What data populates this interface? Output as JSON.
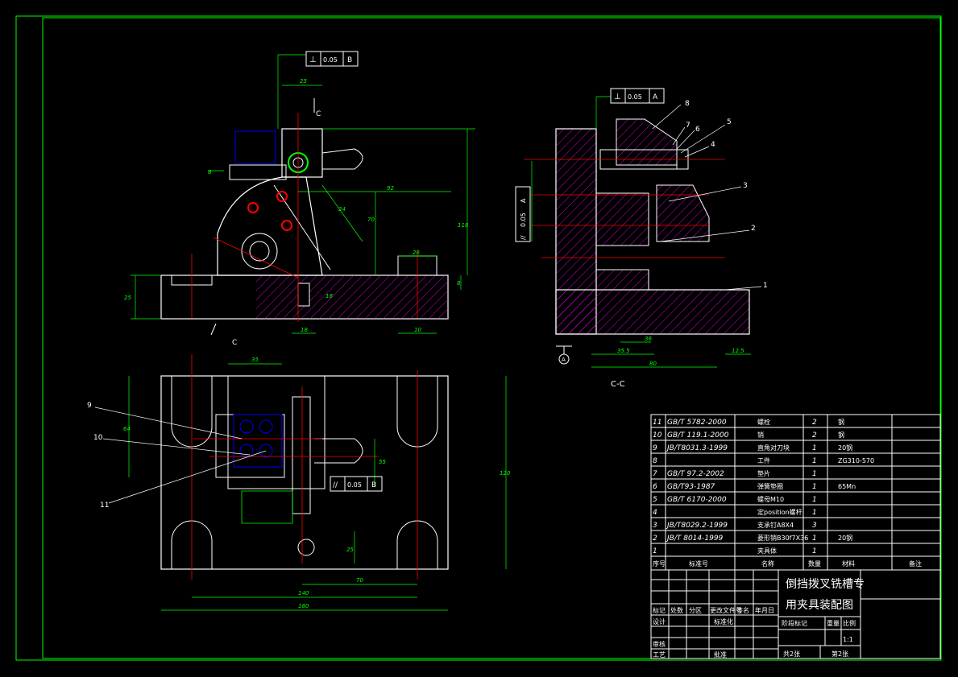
{
  "colors": {
    "background": "#000000",
    "border": "#00ff00",
    "part_outline": "#ffffff",
    "dimension": "#00ff00",
    "centerline": "#ff0000",
    "hatch": "#ff00ff",
    "hidden_blue": "#0000ff",
    "highlight_red": "#ff0000"
  },
  "views": {
    "front": {
      "section_label_top": "C",
      "section_label_bottom": "C",
      "tolerance_frame": [
        "⊥",
        "0.05",
        "B"
      ],
      "dims": [
        "25",
        "92",
        "8",
        "70",
        "24",
        "118",
        "25",
        "26",
        "8",
        "18",
        "18",
        "10"
      ]
    },
    "section": {
      "title": "C-C",
      "tolerance_frame": [
        "⊥",
        "0.05",
        "A"
      ],
      "side_frame": [
        "//",
        "0.05",
        "A"
      ],
      "datum": "A",
      "dims": [
        "36",
        "35.5",
        "80",
        "12.5"
      ],
      "balloons": [
        "8",
        "7",
        "6",
        "5",
        "4",
        "3",
        "2",
        "1"
      ]
    },
    "top": {
      "tolerance_frame": [
        "//",
        "0.05",
        "B"
      ],
      "dims": [
        "35",
        "64",
        "55",
        "120",
        "25",
        "70",
        "140",
        "180"
      ],
      "balloons": [
        "9",
        "10",
        "11"
      ]
    }
  },
  "bom": {
    "rows": [
      {
        "no": "11",
        "std": "GB/T 5782-2000",
        "name": "螺栓",
        "qty": "2",
        "mat": "钢",
        "note": ""
      },
      {
        "no": "10",
        "std": "GB/T 119.1-2000",
        "name": "销",
        "qty": "2",
        "mat": "钢",
        "note": ""
      },
      {
        "no": "9",
        "std": "JB/T8031.3-1999",
        "name": "直角对刀块",
        "qty": "1",
        "mat": "20钢",
        "note": ""
      },
      {
        "no": "8",
        "std": "",
        "name": "工件",
        "qty": "1",
        "mat": "ZG310-570",
        "note": ""
      },
      {
        "no": "7",
        "std": "GB/T 97.2-2002",
        "name": "垫片",
        "qty": "1",
        "mat": "",
        "note": ""
      },
      {
        "no": "6",
        "std": "GB/T93-1987",
        "name": "弹簧垫圈",
        "qty": "1",
        "mat": "65Mn",
        "note": ""
      },
      {
        "no": "5",
        "std": "GB/T 6170-2000",
        "name": "螺母M10",
        "qty": "1",
        "mat": "",
        "note": ""
      },
      {
        "no": "4",
        "std": "",
        "name": "定position螺杆",
        "qty": "1",
        "mat": "",
        "note": ""
      },
      {
        "no": "3",
        "std": "JB/T8029.2-1999",
        "name": "支承钉A8X4",
        "qty": "3",
        "mat": "",
        "note": ""
      },
      {
        "no": "2",
        "std": "JB/T 8014-1999",
        "name": "菱形销B30f7X36",
        "qty": "1",
        "mat": "20钢",
        "note": ""
      },
      {
        "no": "1",
        "std": "",
        "name": "夹具体",
        "qty": "1",
        "mat": "",
        "note": ""
      }
    ],
    "headers": [
      "序号",
      "标准号",
      "名称",
      "数量",
      "材料",
      "备注"
    ]
  },
  "title_block": {
    "title_line1": "倒挡拨叉铣槽专",
    "title_line2": "用夹具装配图",
    "rev_headers": [
      "标记",
      "处数",
      "分区",
      "更改文件号",
      "签名",
      "年月日"
    ],
    "design_label": "设计",
    "std_label": "标准化",
    "review_label": "审核",
    "process_label": "工艺",
    "approve_label": "批准",
    "stage_headers": [
      "阶段标记",
      "重量",
      "比例"
    ],
    "scale": "1:1",
    "sheets_total": "共2张",
    "sheet_no": "第2张"
  }
}
